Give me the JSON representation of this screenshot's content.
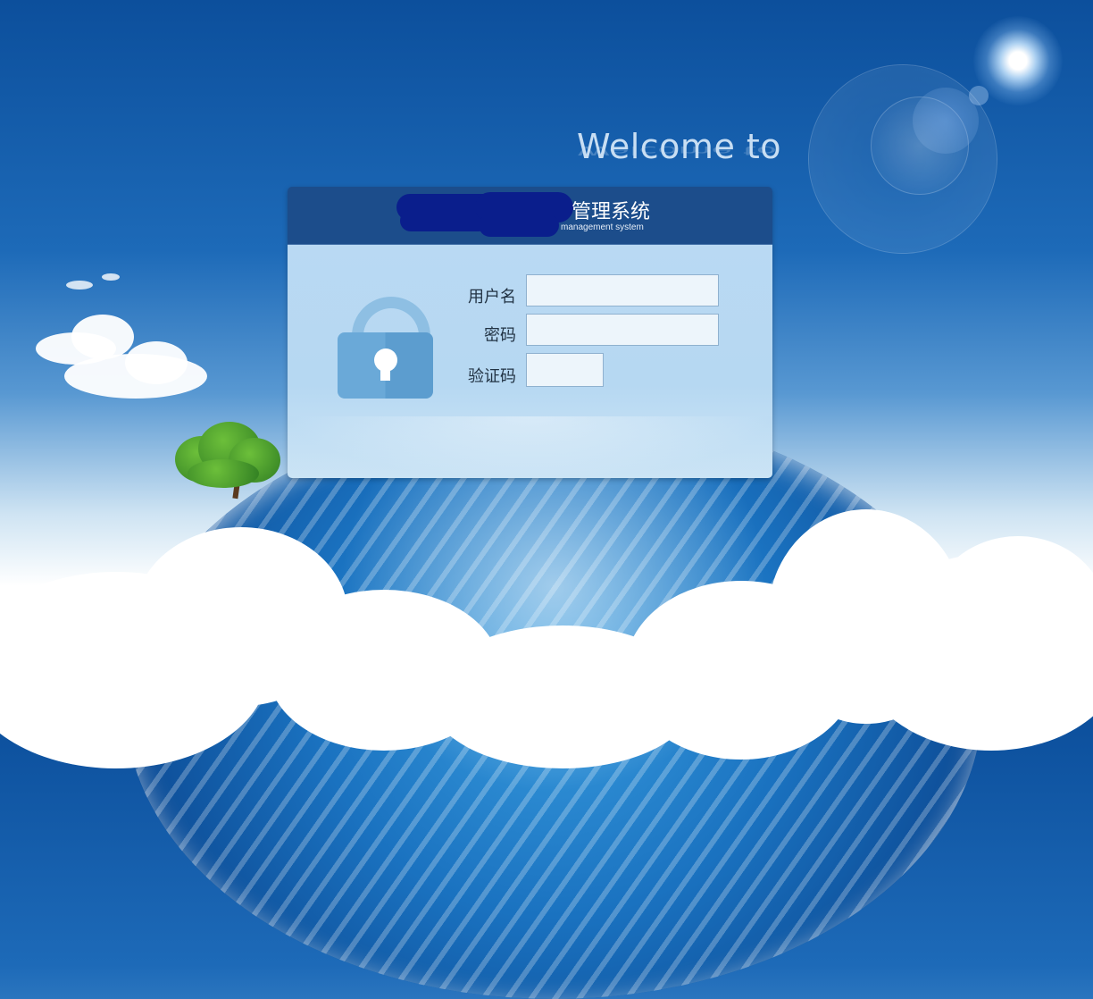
{
  "header": {
    "welcome": "Welcome to",
    "title_cn": "管理系统",
    "title_en": "management system"
  },
  "login": {
    "username_label": "用户名",
    "username_value": "",
    "password_label": "密码",
    "password_value": "",
    "captcha_label": "验证码",
    "captcha_value": ""
  },
  "icons": {
    "lock": "lock-icon"
  },
  "colors": {
    "header_bg": "#1c4d8b",
    "body_bg": "#b9d9f3",
    "sky_top": "#0c4f9c"
  }
}
